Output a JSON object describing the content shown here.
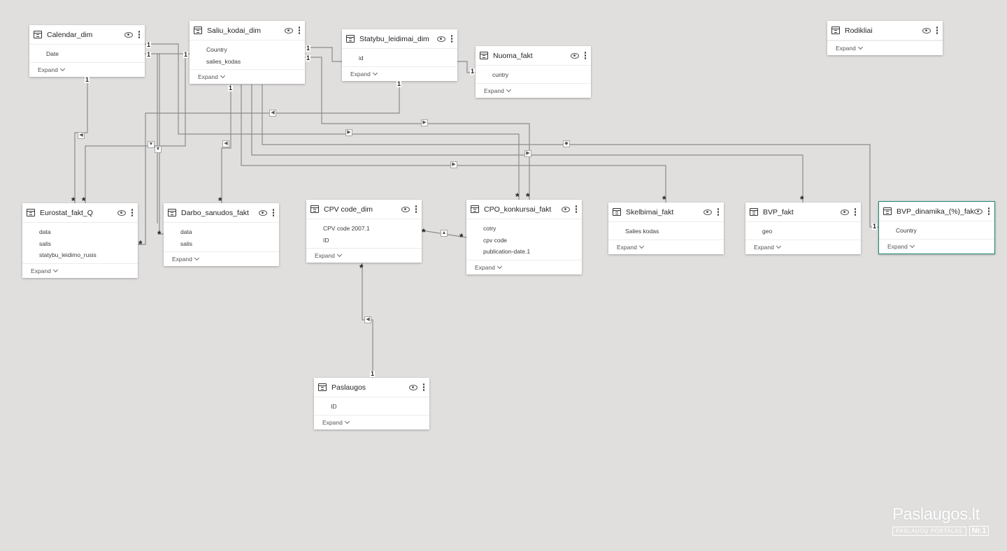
{
  "expand_label": "Expand",
  "tables": [
    {
      "key": "calendar",
      "title": "Calendar_dim",
      "fields": [
        "Date"
      ]
    },
    {
      "key": "saliu",
      "title": "Saliu_kodai_dim",
      "fields": [
        "Country",
        "salies_kodas"
      ]
    },
    {
      "key": "statybu",
      "title": "Statybu_leidimai_dim",
      "fields": [
        "id"
      ]
    },
    {
      "key": "nuoma",
      "title": "Nuoma_fakt",
      "fields": [
        "cuntry"
      ]
    },
    {
      "key": "rodikliai",
      "title": "Rodikliai",
      "fields": []
    },
    {
      "key": "eurostat",
      "title": "Eurostat_fakt_Q",
      "fields": [
        "data",
        "salis",
        "statybu_leidimo_rusis"
      ]
    },
    {
      "key": "darbo",
      "title": "Darbo_sanudos_fakt",
      "fields": [
        "data",
        "salis"
      ]
    },
    {
      "key": "cpv",
      "title": "CPV code_dim",
      "fields": [
        "CPV code 2007.1",
        "ID"
      ]
    },
    {
      "key": "cpo",
      "title": "CPO_konkursai_fakt",
      "fields": [
        "cotry",
        "cpv code",
        "publication-date.1"
      ]
    },
    {
      "key": "skelbimai",
      "title": "Skelbimai_fakt",
      "fields": [
        "Salies kodas"
      ]
    },
    {
      "key": "bvp",
      "title": "BVP_fakt",
      "fields": [
        "geo"
      ]
    },
    {
      "key": "bvpdin",
      "title": "BVP_dinamika_(%)_fakt",
      "fields": [
        "Country"
      ],
      "selected": true
    },
    {
      "key": "paslaugos",
      "title": "Paslaugos",
      "fields": [
        "ID"
      ]
    }
  ],
  "relationships": [
    {
      "from": "calendar",
      "from_card": "1",
      "to": "eurostat",
      "to_card": "*"
    },
    {
      "from": "calendar",
      "from_card": "1",
      "to": "darbo",
      "to_card": "*"
    },
    {
      "from": "calendar",
      "from_card": "1",
      "to": "cpo",
      "to_card": "*"
    },
    {
      "from": "saliu",
      "from_card": "1",
      "to": "eurostat",
      "to_card": "*"
    },
    {
      "from": "saliu",
      "from_card": "1",
      "to": "darbo",
      "to_card": "*"
    },
    {
      "from": "saliu",
      "from_card": "1",
      "to": "skelbimai",
      "to_card": "*"
    },
    {
      "from": "saliu",
      "from_card": "1",
      "to": "bvp",
      "to_card": "*"
    },
    {
      "from": "saliu",
      "from_card": "1",
      "to": "bvpdin",
      "to_card": "1"
    },
    {
      "from": "statybu",
      "from_card": "1",
      "to": "nuoma",
      "to_card": "1"
    },
    {
      "from": "statybu",
      "from_card": "1",
      "to": "eurostat",
      "to_card": "*"
    },
    {
      "from": "statybu",
      "from_card": "1",
      "to": "cpo",
      "to_card": "*"
    },
    {
      "from": "cpv",
      "from_card": "*",
      "to": "cpo",
      "to_card": "*"
    },
    {
      "from": "paslaugos",
      "from_card": "1",
      "to": "cpv",
      "to_card": "*"
    }
  ],
  "watermark": {
    "title": "Paslaugos.lt",
    "subtitle": "PASLAUGŲ PORTALAS",
    "badge": "Nr.1"
  }
}
